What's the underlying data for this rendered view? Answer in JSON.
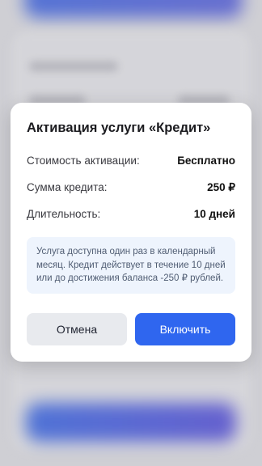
{
  "dialog": {
    "title": "Активация услуги «Кредит»",
    "rows": [
      {
        "label": "Стоимость активации:",
        "value": "Бесплатно"
      },
      {
        "label": "Сумма кредита:",
        "value": "250 ₽"
      },
      {
        "label": "Длительность:",
        "value": "10 дней"
      }
    ],
    "note": "Услуга доступна один раз в календарный месяц. Кредит действует в течение 10 дней или до достижения баланса -250 ₽ рублей.",
    "cancel_label": "Отмена",
    "confirm_label": "Включить"
  },
  "colors": {
    "accent": "#2f66ef",
    "note_bg": "#eef4fd",
    "cancel_bg": "#e8eaee"
  }
}
